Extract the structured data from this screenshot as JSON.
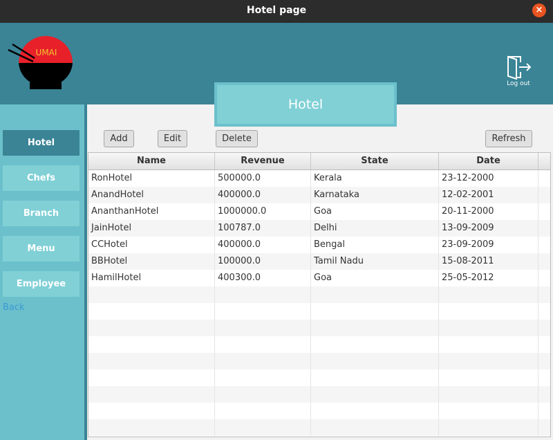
{
  "window": {
    "title": "Hotel page",
    "close_icon": "×"
  },
  "header": {
    "logo_text": "UMAI",
    "logout_label": "Log out",
    "banner": "Hotel"
  },
  "sidebar": {
    "items": [
      {
        "label": "Hotel",
        "active": true
      },
      {
        "label": "Chefs"
      },
      {
        "label": "Branch"
      },
      {
        "label": "Menu"
      },
      {
        "label": "Employee"
      }
    ],
    "back": "Back"
  },
  "toolbar": {
    "add": "Add",
    "edit": "Edit",
    "delete": "Delete",
    "refresh": "Refresh"
  },
  "table": {
    "columns": [
      "Name",
      "Revenue",
      "State",
      "Date"
    ],
    "rows": [
      [
        "RonHotel",
        "500000.0",
        "Kerala",
        "23-12-2000"
      ],
      [
        "AnandHotel",
        "400000.0",
        "Karnataka",
        "12-02-2001"
      ],
      [
        "AnanthanHotel",
        "1000000.0",
        "Goa",
        "20-11-2000"
      ],
      [
        "JainHotel",
        "100787.0",
        "Delhi",
        "13-09-2009"
      ],
      [
        "CCHotel",
        "400000.0",
        "Bengal",
        "23-09-2009"
      ],
      [
        "BBHotel",
        "100000.0",
        "Tamil Nadu",
        "15-08-2011"
      ],
      [
        "HamilHotel",
        "400300.0",
        "Goa",
        "25-05-2012"
      ]
    ]
  }
}
